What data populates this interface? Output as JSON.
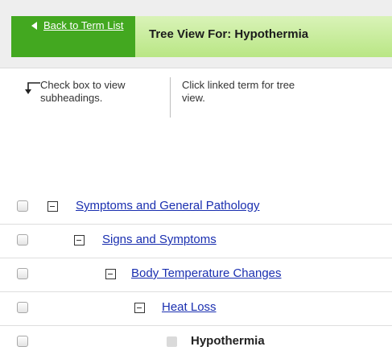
{
  "header": {
    "back_link": "Back to Term List",
    "title": "Tree View For: Hypothermia"
  },
  "instructions": {
    "checkbox_hint": "Check box to view subheadings.",
    "link_hint": "Click linked term for tree view."
  },
  "tree": [
    {
      "label": "Symptoms and General Pathology",
      "linked": true,
      "expanded": true
    },
    {
      "label": "Signs and Symptoms",
      "linked": true,
      "expanded": true
    },
    {
      "label": "Body Temperature Changes",
      "linked": true,
      "expanded": true
    },
    {
      "label": "Heat Loss",
      "linked": true,
      "expanded": true
    },
    {
      "label": "Hypothermia",
      "linked": false,
      "expanded": false
    }
  ],
  "icons": {
    "back": "triangle-left-icon",
    "check_hint": "bent-arrow-icon",
    "expand": "minus-box-icon",
    "leaf": "leaf-box-icon"
  },
  "colors": {
    "header_green": "#43a820",
    "title_green": "#c9ed9f",
    "link_blue": "#1a2fb0"
  }
}
